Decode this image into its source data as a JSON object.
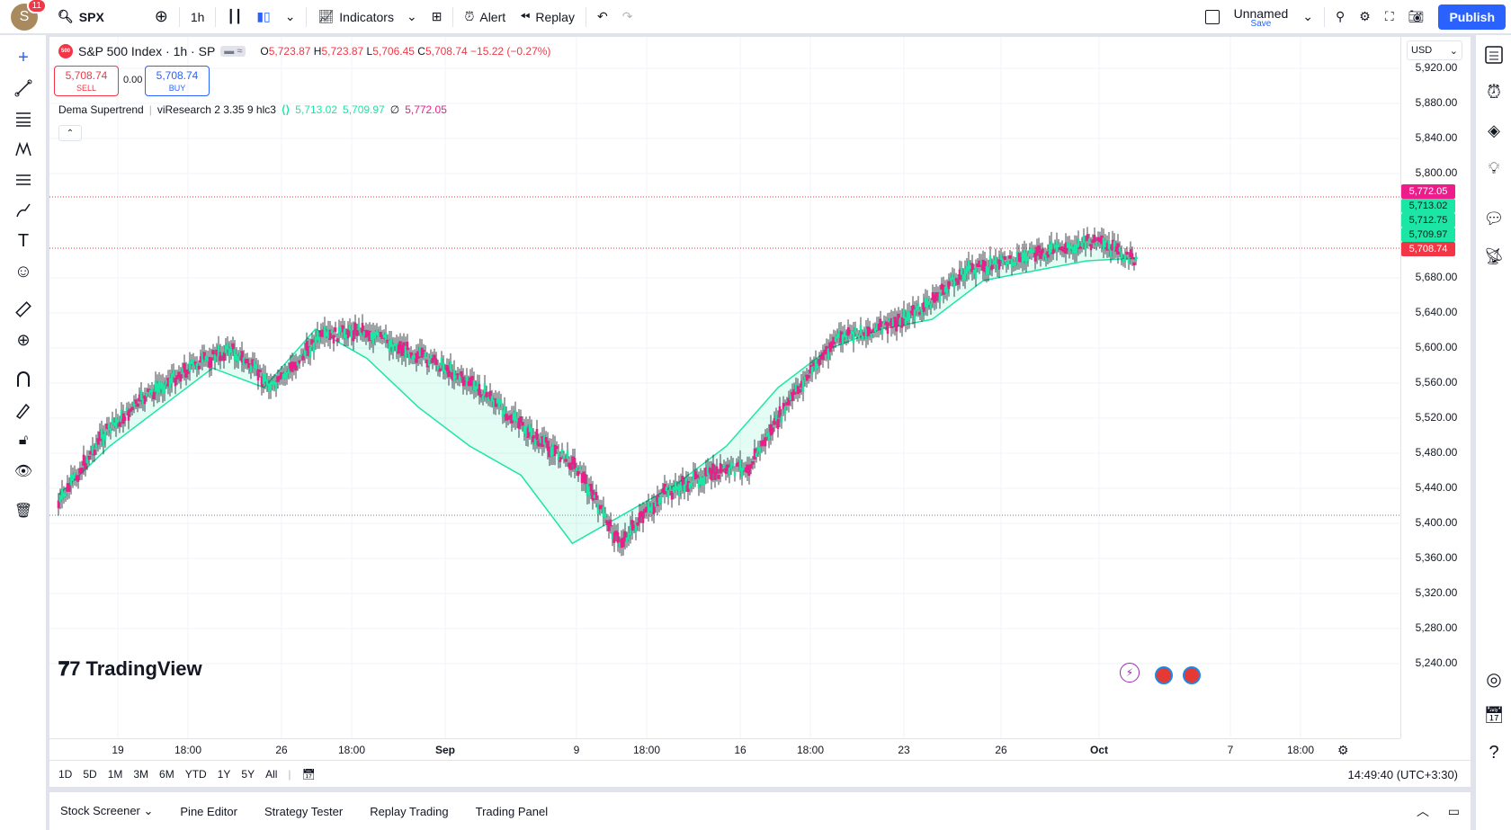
{
  "topbar": {
    "avatar_letter": "S",
    "avatar_badge": "11",
    "symbol": "SPX",
    "interval": "1h",
    "indicators_label": "Indicators",
    "alert_label": "Alert",
    "replay_label": "Replay",
    "layout_name": "Unnamed",
    "layout_save": "Save",
    "publish_label": "Publish"
  },
  "legend": {
    "sym_badge": "500",
    "title": "S&P 500 Index · 1h · SP",
    "O_label": "O",
    "O": "5,723.87",
    "H_label": "H",
    "H": "5,723.87",
    "L_label": "L",
    "L": "5,706.45",
    "C_label": "C",
    "C": "5,708.74",
    "change": "−15.22 (−0.27%)",
    "sell_price": "5,708.74",
    "sell_label": "SELL",
    "spread": "0.00",
    "buy_price": "5,708.74",
    "buy_label": "BUY",
    "indicator_name": "Dema Supertrend",
    "indicator_params": "viResearch 2 3.35 9 hlc3",
    "ind_v1": "5,713.02",
    "ind_v2": "5,709.97",
    "ind_v3_prefix": "∅",
    "ind_v3": "5,772.05"
  },
  "price_axis": {
    "currency": "USD",
    "labels": [
      "5,920.00",
      "5,880.00",
      "5,840.00",
      "5,800.00",
      "5,680.00",
      "5,640.00",
      "5,600.00",
      "5,560.00",
      "5,520.00",
      "5,480.00",
      "5,440.00",
      "5,400.00",
      "5,360.00",
      "5,320.00",
      "5,280.00",
      "5,240.00"
    ],
    "tags": [
      {
        "text": "5,772.05",
        "color": "#ec1d8b"
      },
      {
        "text": "5,713.02",
        "color": "#1ce6a3"
      },
      {
        "text": "5,712.75",
        "color": "#1ce6a3"
      },
      {
        "text": "5,709.97",
        "color": "#1ce6a3"
      },
      {
        "text": "5,708.74",
        "color": "#f23645"
      }
    ]
  },
  "time_axis": {
    "labels": [
      "19",
      "18:00",
      "26",
      "18:00",
      "Sep",
      "9",
      "18:00",
      "16",
      "18:00",
      "23",
      "26",
      "Oct",
      "7",
      "18:00"
    ]
  },
  "range_bar": {
    "ranges": [
      "1D",
      "5D",
      "1M",
      "3M",
      "6M",
      "YTD",
      "1Y",
      "5Y",
      "All"
    ],
    "clock": "14:49:40 (UTC+3:30)"
  },
  "bottom_panel": {
    "tabs": [
      "Stock Screener",
      "Pine Editor",
      "Strategy Tester",
      "Replay Trading",
      "Trading Panel"
    ]
  },
  "branding": {
    "logo_text": "TradingView"
  },
  "colors": {
    "bull": "#1ce6a3",
    "bear": "#ec1d8b",
    "accent": "#2962ff",
    "down": "#f23645"
  },
  "chart_data": {
    "type": "candlestick",
    "title": "S&P 500 Index · 1h · SP",
    "ylim": [
      5220,
      5940
    ],
    "x_categories": [
      "19",
      "18:00",
      "26",
      "18:00",
      "Sep",
      "9",
      "18:00",
      "16",
      "18:00",
      "23",
      "26",
      "Oct",
      "7",
      "18:00"
    ],
    "series": [
      {
        "name": "Dema Supertrend",
        "values": [
          5470,
          5520,
          5560,
          5600,
          5580,
          5640,
          5610,
          5560,
          5520,
          5490,
          5420,
          5450,
          5480,
          5520,
          5580,
          5620,
          5640,
          5650,
          5690,
          5700,
          5710,
          5713
        ]
      }
    ],
    "close": [
      5460,
      5530,
      5570,
      5600,
      5620,
      5580,
      5630,
      5640,
      5620,
      5600,
      5570,
      5530,
      5500,
      5420,
      5470,
      5490,
      5500,
      5570,
      5630,
      5640,
      5660,
      5700,
      5710,
      5720,
      5730,
      5709
    ]
  }
}
